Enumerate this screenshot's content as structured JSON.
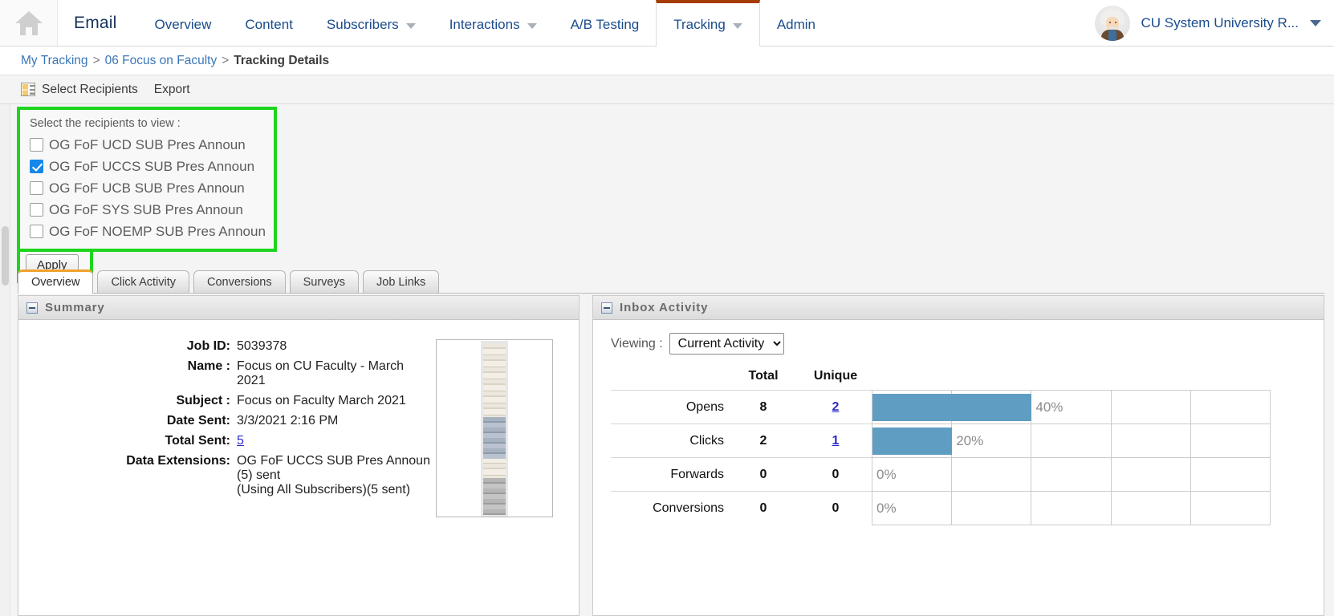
{
  "topnav": {
    "home_icon": "home-icon",
    "app_name": "Email",
    "items": [
      {
        "label": "Overview",
        "has_caret": false,
        "active": false
      },
      {
        "label": "Content",
        "has_caret": false,
        "active": false
      },
      {
        "label": "Subscribers",
        "has_caret": true,
        "active": false
      },
      {
        "label": "Interactions",
        "has_caret": true,
        "active": false
      },
      {
        "label": "A/B Testing",
        "has_caret": false,
        "active": false
      },
      {
        "label": "Tracking",
        "has_caret": true,
        "active": true
      },
      {
        "label": "Admin",
        "has_caret": false,
        "active": false
      }
    ],
    "user": {
      "avatar": "einstein-avatar",
      "name": "CU System University R...",
      "caret": "chevron-down-icon"
    },
    "active_tab_accent": "#a63c06"
  },
  "breadcrumb": {
    "links": [
      "My Tracking",
      "06 Focus on Faculty"
    ],
    "separator": ">",
    "current": "Tracking Details"
  },
  "toolbar": {
    "select_recipients": "Select Recipients",
    "export": "Export"
  },
  "recipients": {
    "title": "Select the recipients to view :",
    "items": [
      {
        "label": "OG FoF UCD SUB Pres Announ",
        "checked": false
      },
      {
        "label": "OG FoF UCCS SUB Pres Announ",
        "checked": true
      },
      {
        "label": "OG FoF UCB SUB Pres Announ",
        "checked": false
      },
      {
        "label": "OG FoF SYS SUB Pres Announ",
        "checked": false
      },
      {
        "label": "OG FoF NOEMP SUB Pres Announ",
        "checked": false
      }
    ],
    "apply_label": "Apply",
    "highlight_color": "#1ed51e"
  },
  "tabs": [
    {
      "label": "Overview",
      "active": true
    },
    {
      "label": "Click Activity",
      "active": false
    },
    {
      "label": "Conversions",
      "active": false
    },
    {
      "label": "Surveys",
      "active": false
    },
    {
      "label": "Job Links",
      "active": false
    }
  ],
  "summary": {
    "panel_title": "Summary",
    "rows": [
      {
        "key": "Job ID:",
        "value": "5039378",
        "link": false
      },
      {
        "key": "Name :",
        "value": "Focus on CU Faculty - March 2021",
        "link": false
      },
      {
        "key": "Subject :",
        "value": "Focus on Faculty March 2021",
        "link": false
      },
      {
        "key": "Date Sent:",
        "value": "3/3/2021 2:16 PM",
        "link": false
      },
      {
        "key": "Total Sent:",
        "value": "5",
        "link": true
      }
    ],
    "data_extensions_key": "Data Extensions:",
    "data_extensions_line1": "OG FoF UCCS SUB Pres Announ (5) sent",
    "data_extensions_line2": "(Using All Subscribers)(5 sent)",
    "thumbnail": "email-preview-thumbnail"
  },
  "inbox_activity": {
    "panel_title": "Inbox Activity",
    "viewing_label": "Viewing :",
    "viewing_value": "Current Activity",
    "viewing_options": [
      "Current Activity"
    ],
    "columns": [
      "",
      "Total",
      "Unique"
    ]
  },
  "chart_data": {
    "type": "bar",
    "title": "Inbox Activity",
    "categories": [
      "Opens",
      "Clicks",
      "Forwards",
      "Conversions"
    ],
    "series": [
      {
        "name": "Total",
        "values": [
          8,
          2,
          0,
          0
        ]
      },
      {
        "name": "Unique",
        "values": [
          2,
          1,
          0,
          0
        ]
      }
    ],
    "percent_values": [
      40,
      20,
      0,
      0
    ],
    "percent_labels": [
      "40%",
      "20%",
      "0%",
      "0%"
    ],
    "unique_is_link": [
      true,
      true,
      false,
      false
    ],
    "xlabel": "",
    "ylabel": "",
    "xlim": [
      0,
      100
    ],
    "grid": true,
    "gridline_interval": 20,
    "bar_color": "#5f9dc3",
    "legend": "none"
  }
}
